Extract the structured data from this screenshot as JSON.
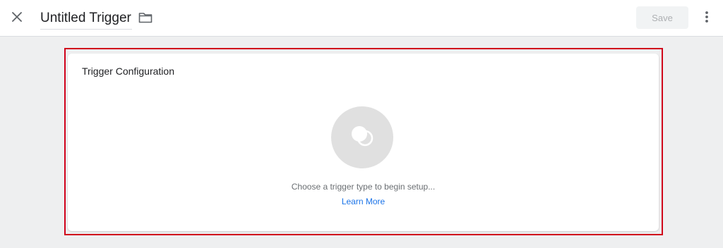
{
  "header": {
    "title": "Untitled Trigger",
    "save_label": "Save"
  },
  "icons": {
    "close": "close-icon",
    "folder": "folder-icon",
    "more": "more-vert-icon",
    "trigger": "trigger-type-icon"
  },
  "card": {
    "title": "Trigger Configuration",
    "hint": "Choose a trigger type to begin setup...",
    "learn_more": "Learn More"
  },
  "colors": {
    "highlight": "#d0021b",
    "link": "#1a73e8",
    "page_background": "#eeeff0"
  }
}
